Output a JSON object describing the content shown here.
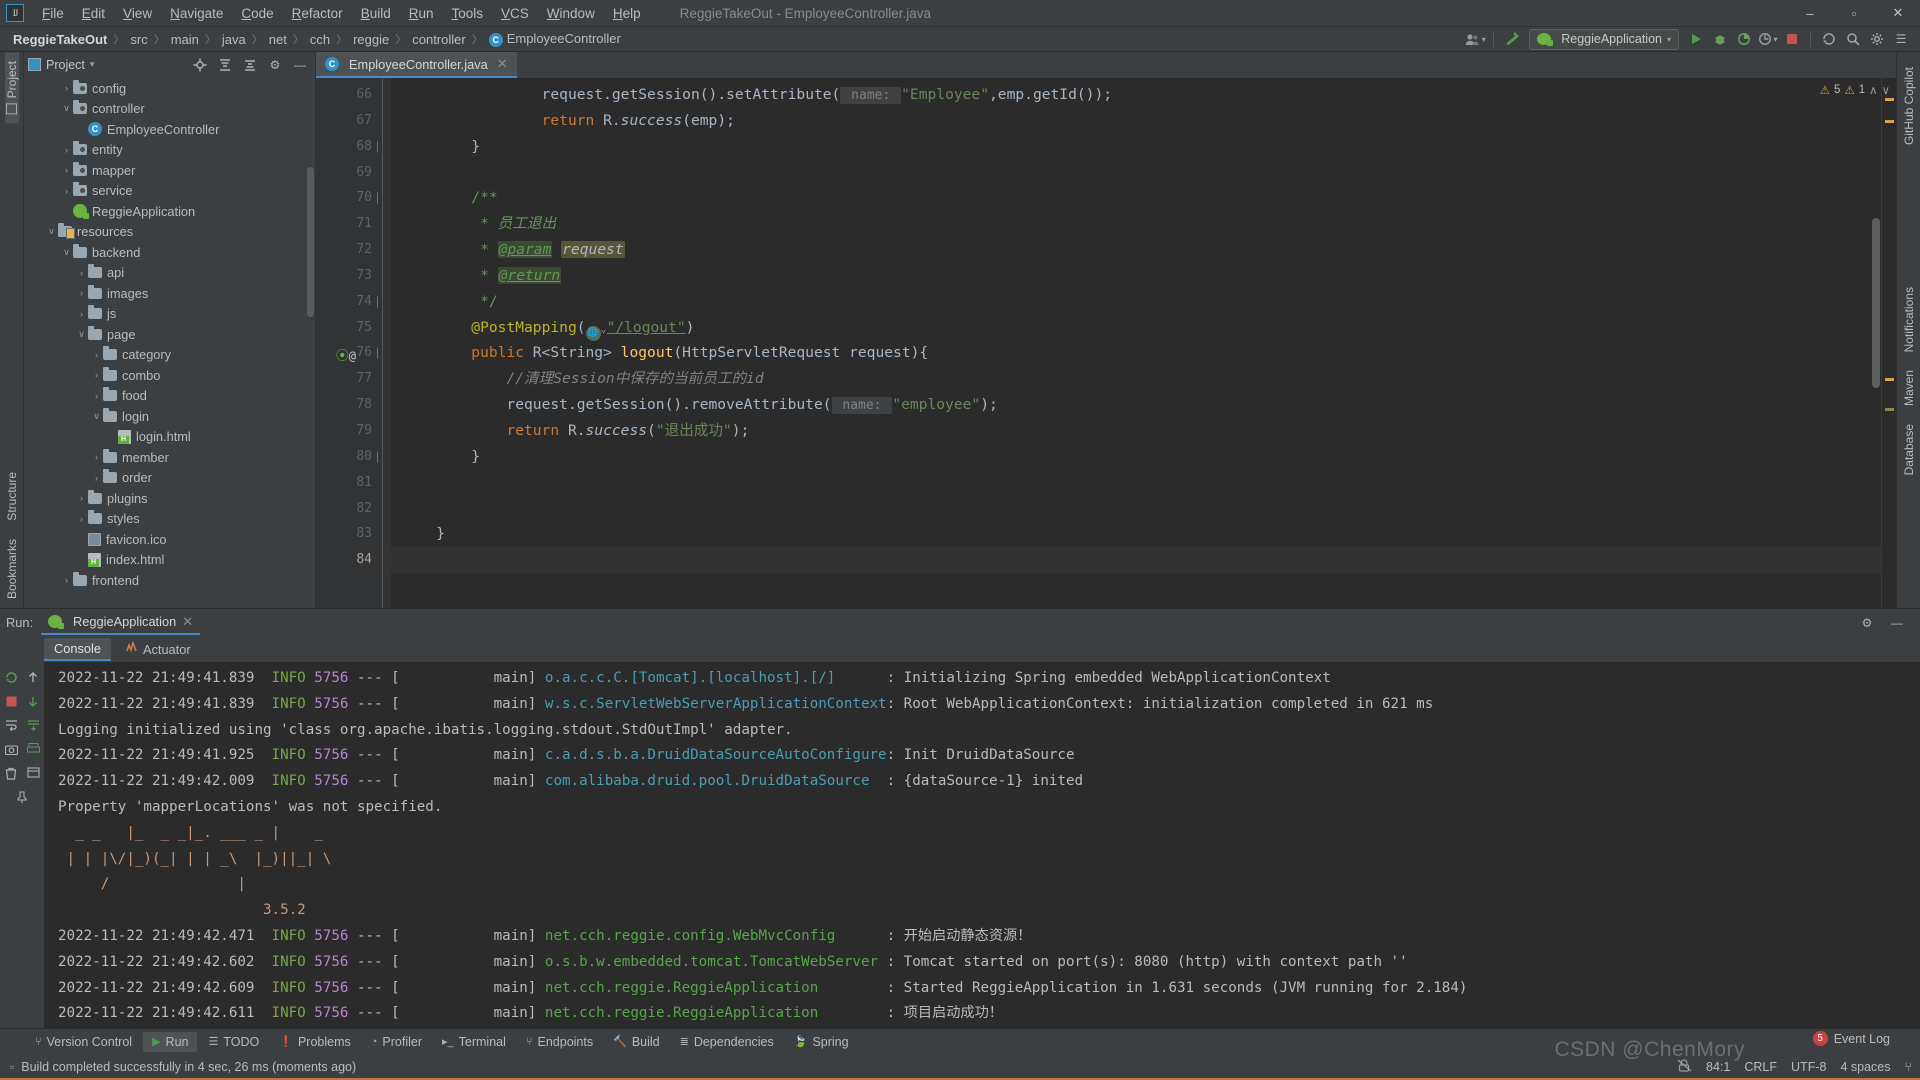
{
  "window": {
    "title": "ReggieTakeOut - EmployeeController.java",
    "minimize": "–",
    "maximize": "▫",
    "close": "✕"
  },
  "menu": {
    "logo": "IJ",
    "items": [
      "File",
      "Edit",
      "View",
      "Navigate",
      "Code",
      "Refactor",
      "Build",
      "Run",
      "Tools",
      "VCS",
      "Window",
      "Help"
    ]
  },
  "breadcrumb": {
    "project": "ReggieTakeOut",
    "parts": [
      "src",
      "main",
      "java",
      "net",
      "cch",
      "reggie",
      "controller"
    ],
    "file": "EmployeeController",
    "file_icon": "C",
    "separator": "〉"
  },
  "toolbar": {
    "profiles_icon": "👥",
    "hammer_icon": "build-hammer",
    "run_config": "ReggieApplication",
    "run_icon": "▶",
    "debug_icon": "🐞",
    "coverage_icon": "◷",
    "profile_icon": "◔",
    "stop_icon": "■",
    "update_icon": "↺",
    "search_icon": "🔍",
    "settings_icon": "⚙",
    "layout_icon": "☰"
  },
  "left_rail": {
    "project": "Project",
    "structure": "Structure",
    "bookmarks": "Bookmarks"
  },
  "right_rail": {
    "copilot": "GitHub Copilot",
    "notifications": "Notifications",
    "maven": "Maven",
    "database": "Database"
  },
  "project_panel": {
    "title": "Project",
    "dropdown": "▾",
    "locate_icon": "⊕",
    "expand_icon": "≡",
    "collapse_icon": "≣",
    "settings_icon": "⚙",
    "hide_icon": "—",
    "tree": [
      {
        "label": "config",
        "indent": 2,
        "arrow": "›",
        "icon": "folder-src"
      },
      {
        "label": "controller",
        "indent": 2,
        "arrow": "∨",
        "icon": "folder-src"
      },
      {
        "label": "EmployeeController",
        "indent": 3,
        "arrow": "",
        "icon": "class"
      },
      {
        "label": "entity",
        "indent": 2,
        "arrow": "›",
        "icon": "folder-src"
      },
      {
        "label": "mapper",
        "indent": 2,
        "arrow": "›",
        "icon": "folder-src"
      },
      {
        "label": "service",
        "indent": 2,
        "arrow": "›",
        "icon": "folder-src"
      },
      {
        "label": "ReggieApplication",
        "indent": 2,
        "arrow": "",
        "icon": "spring"
      },
      {
        "label": "resources",
        "indent": 1,
        "arrow": "∨",
        "icon": "folder-res"
      },
      {
        "label": "backend",
        "indent": 2,
        "arrow": "∨",
        "icon": "folder"
      },
      {
        "label": "api",
        "indent": 3,
        "arrow": "›",
        "icon": "folder"
      },
      {
        "label": "images",
        "indent": 3,
        "arrow": "›",
        "icon": "folder"
      },
      {
        "label": "js",
        "indent": 3,
        "arrow": "›",
        "icon": "folder"
      },
      {
        "label": "page",
        "indent": 3,
        "arrow": "∨",
        "icon": "folder"
      },
      {
        "label": "category",
        "indent": 4,
        "arrow": "›",
        "icon": "folder"
      },
      {
        "label": "combo",
        "indent": 4,
        "arrow": "›",
        "icon": "folder"
      },
      {
        "label": "food",
        "indent": 4,
        "arrow": "›",
        "icon": "folder"
      },
      {
        "label": "login",
        "indent": 4,
        "arrow": "∨",
        "icon": "folder"
      },
      {
        "label": "login.html",
        "indent": 5,
        "arrow": "",
        "icon": "html"
      },
      {
        "label": "member",
        "indent": 4,
        "arrow": "›",
        "icon": "folder"
      },
      {
        "label": "order",
        "indent": 4,
        "arrow": "›",
        "icon": "folder"
      },
      {
        "label": "plugins",
        "indent": 3,
        "arrow": "›",
        "icon": "folder"
      },
      {
        "label": "styles",
        "indent": 3,
        "arrow": "›",
        "icon": "folder"
      },
      {
        "label": "favicon.ico",
        "indent": 3,
        "arrow": "",
        "icon": "ico"
      },
      {
        "label": "index.html",
        "indent": 3,
        "arrow": "",
        "icon": "html"
      },
      {
        "label": "frontend",
        "indent": 2,
        "arrow": "›",
        "icon": "folder"
      }
    ]
  },
  "editor": {
    "tab": {
      "label": "EmployeeController.java",
      "icon": "C",
      "close": "✕"
    },
    "inspection": {
      "warnings": "5",
      "weak_warnings": "1",
      "warn_icon": "⚠",
      "weak_icon": "⚠",
      "up": "∧",
      "down": "∨"
    },
    "first_line_number": 66,
    "lines": [
      {
        "n": 66,
        "fold": "",
        "marks": "",
        "segments": [
          {
            "t": "                ",
            "c": "txt"
          },
          {
            "t": "request",
            "c": "txt"
          },
          {
            "t": ".getSession().setAttribute(",
            "c": "txt"
          },
          {
            "t": " name: ",
            "c": "hint"
          },
          {
            "t": "\"Employee\"",
            "c": "str"
          },
          {
            "t": ",emp.getId());",
            "c": "txt"
          }
        ]
      },
      {
        "n": 67,
        "fold": "",
        "marks": "",
        "segments": [
          {
            "t": "                ",
            "c": "txt"
          },
          {
            "t": "return",
            "c": "kw"
          },
          {
            "t": " R.",
            "c": "txt"
          },
          {
            "t": "success",
            "c": "txt-ital"
          },
          {
            "t": "(emp);",
            "c": "txt"
          }
        ]
      },
      {
        "n": 68,
        "fold": "⊖",
        "marks": "",
        "segments": [
          {
            "t": "        }",
            "c": "txt"
          }
        ]
      },
      {
        "n": 69,
        "fold": "",
        "marks": "",
        "segments": []
      },
      {
        "n": 70,
        "fold": "⊖",
        "marks": "",
        "segments": [
          {
            "t": "        ",
            "c": "txt"
          },
          {
            "t": "/**",
            "c": "jdoc"
          }
        ]
      },
      {
        "n": 71,
        "fold": "",
        "marks": "",
        "segments": [
          {
            "t": "         ",
            "c": "txt"
          },
          {
            "t": "* ",
            "c": "jdoc"
          },
          {
            "t": "员工退出",
            "c": "jdoc-ital"
          }
        ]
      },
      {
        "n": 72,
        "fold": "",
        "marks": "",
        "segments": [
          {
            "t": "         ",
            "c": "txt"
          },
          {
            "t": "* ",
            "c": "jdoc"
          },
          {
            "t": "@param",
            "c": "jdtag-hl"
          },
          {
            "t": " ",
            "c": "txt"
          },
          {
            "t": "request",
            "c": "param-hl"
          }
        ]
      },
      {
        "n": 73,
        "fold": "",
        "marks": "",
        "segments": [
          {
            "t": "         ",
            "c": "txt"
          },
          {
            "t": "* ",
            "c": "jdoc"
          },
          {
            "t": "@return",
            "c": "jdtag-hl"
          }
        ]
      },
      {
        "n": 74,
        "fold": "⊖",
        "marks": "",
        "segments": [
          {
            "t": "         ",
            "c": "txt"
          },
          {
            "t": "*/",
            "c": "jdoc"
          }
        ]
      },
      {
        "n": 75,
        "fold": "",
        "marks": "",
        "segments": [
          {
            "t": "        ",
            "c": "txt"
          },
          {
            "t": "@PostMapping",
            "c": "ann"
          },
          {
            "t": "(",
            "c": "txt"
          },
          {
            "t": "globe",
            "c": "globe-icon"
          },
          {
            "t": "\"/logout\"",
            "c": "linkstr"
          },
          {
            "t": ")",
            "c": "txt"
          }
        ]
      },
      {
        "n": 76,
        "fold": "⊖",
        "marks": "spring@",
        "segments": [
          {
            "t": "        ",
            "c": "txt"
          },
          {
            "t": "public",
            "c": "kw"
          },
          {
            "t": " R<String> ",
            "c": "txt"
          },
          {
            "t": "logout",
            "c": "fn"
          },
          {
            "t": "(HttpServletRequest request){",
            "c": "txt"
          }
        ]
      },
      {
        "n": 77,
        "fold": "",
        "marks": "",
        "segments": [
          {
            "t": "            ",
            "c": "txt"
          },
          {
            "t": "//清理Session中保存的当前员工的id",
            "c": "cmt-ital"
          }
        ]
      },
      {
        "n": 78,
        "fold": "",
        "marks": "",
        "segments": [
          {
            "t": "            ",
            "c": "txt"
          },
          {
            "t": "request.getSession().removeAttribute(",
            "c": "txt"
          },
          {
            "t": " name: ",
            "c": "hint"
          },
          {
            "t": "\"employee\"",
            "c": "str"
          },
          {
            "t": ");",
            "c": "txt"
          }
        ]
      },
      {
        "n": 79,
        "fold": "",
        "marks": "",
        "segments": [
          {
            "t": "            ",
            "c": "txt"
          },
          {
            "t": "return",
            "c": "kw"
          },
          {
            "t": " R.",
            "c": "txt"
          },
          {
            "t": "success",
            "c": "txt-ital"
          },
          {
            "t": "(",
            "c": "txt"
          },
          {
            "t": "\"退出成功\"",
            "c": "str"
          },
          {
            "t": ");",
            "c": "txt"
          }
        ]
      },
      {
        "n": 80,
        "fold": "⊖",
        "marks": "",
        "segments": [
          {
            "t": "        }",
            "c": "txt"
          }
        ]
      },
      {
        "n": 81,
        "fold": "",
        "marks": "",
        "segments": []
      },
      {
        "n": 82,
        "fold": "",
        "marks": "",
        "segments": []
      },
      {
        "n": 83,
        "fold": "",
        "marks": "",
        "segments": [
          {
            "t": "    }",
            "c": "txt"
          }
        ]
      },
      {
        "n": 84,
        "fold": "",
        "marks": "",
        "segments": []
      }
    ]
  },
  "run_panel": {
    "label": "Run:",
    "tab": "ReggieApplication",
    "tab_close": "✕",
    "settings_icon": "⚙",
    "hide_icon": "—",
    "sub_tabs": [
      {
        "label": "Console",
        "selected": true
      },
      {
        "label": "Actuator",
        "selected": false
      }
    ],
    "rail_icons": [
      "↻",
      "↑",
      "↓",
      "■",
      "⇥",
      "⎇",
      "📷",
      "⤓",
      "☰",
      "🗑",
      "⬇",
      "📌"
    ],
    "console_lines": [
      {
        "type": "log",
        "ts": "2022-11-22 21:49:41.839",
        "level": "INFO",
        "pid": "5756",
        "thread": "main]",
        "logger": "o.a.c.c.C.[Tomcat].[localhost].[/]",
        "colon": ":",
        "msg": "Initializing Spring embedded WebApplicationContext"
      },
      {
        "type": "log",
        "ts": "2022-11-22 21:49:41.839",
        "level": "INFO",
        "pid": "5756",
        "thread": "main]",
        "logger": "w.s.c.ServletWebServerApplicationContext",
        "colon": ":",
        "msg": "Root WebApplicationContext: initialization completed in 621 ms"
      },
      {
        "type": "plain",
        "text": "Logging initialized using 'class org.apache.ibatis.logging.stdout.StdOutImpl' adapter."
      },
      {
        "type": "log",
        "ts": "2022-11-22 21:49:41.925",
        "level": "INFO",
        "pid": "5756",
        "thread": "main]",
        "logger": "c.a.d.s.b.a.DruidDataSourceAutoConfigure",
        "colon": ":",
        "msg": "Init DruidDataSource"
      },
      {
        "type": "log",
        "ts": "2022-11-22 21:49:42.009",
        "level": "INFO",
        "pid": "5756",
        "thread": "main]",
        "logger": "com.alibaba.druid.pool.DruidDataSource",
        "colon": ":",
        "msg": "{dataSource-1} inited"
      },
      {
        "type": "plain",
        "text": "Property 'mapperLocations' was not specified."
      },
      {
        "type": "banner",
        "text": "  _ _   |_  _ _|_. ___ _ |    _ "
      },
      {
        "type": "banner",
        "text": " | | |\\/|_)(_| | | _\\  |_)||_| \\"
      },
      {
        "type": "banner",
        "text": "     /               |         "
      },
      {
        "type": "banner",
        "text": "                        3.5.2  "
      },
      {
        "type": "log",
        "ts": "2022-11-22 21:49:42.471",
        "level": "INFO",
        "pid": "5756",
        "thread": "main]",
        "logger": "net.cch.reggie.config.WebMvcConfig",
        "colon": ":",
        "msg": "开始启动静态资源！"
      },
      {
        "type": "log",
        "ts": "2022-11-22 21:49:42.602",
        "level": "INFO",
        "pid": "5756",
        "thread": "main]",
        "logger": "o.s.b.w.embedded.tomcat.TomcatWebServer",
        "colon": ":",
        "msg": "Tomcat started on port(s): 8080 (http) with context path ''"
      },
      {
        "type": "log",
        "ts": "2022-11-22 21:49:42.609",
        "level": "INFO",
        "pid": "5756",
        "thread": "main]",
        "logger": "net.cch.reggie.ReggieApplication",
        "colon": ":",
        "msg": "Started ReggieApplication in 1.631 seconds (JVM running for 2.184)"
      },
      {
        "type": "log",
        "ts": "2022-11-22 21:49:42.611",
        "level": "INFO",
        "pid": "5756",
        "thread": "main]",
        "logger": "net.cch.reggie.ReggieApplication",
        "colon": ":",
        "msg": "项目启动成功！"
      }
    ]
  },
  "tool_window_bar": [
    {
      "label": "Version Control",
      "icon": "⑂",
      "selected": false
    },
    {
      "label": "Run",
      "icon": "▶",
      "selected": true
    },
    {
      "label": "TODO",
      "icon": "☰",
      "selected": false
    },
    {
      "label": "Problems",
      "icon": "❗",
      "selected": false
    },
    {
      "label": "Profiler",
      "icon": "◔",
      "selected": false
    },
    {
      "label": "Terminal",
      "icon": "▸_",
      "selected": false
    },
    {
      "label": "Endpoints",
      "icon": "⑂",
      "selected": false
    },
    {
      "label": "Build",
      "icon": "🔨",
      "selected": false
    },
    {
      "label": "Dependencies",
      "icon": "≣",
      "selected": false
    },
    {
      "label": "Spring",
      "icon": "🍃",
      "selected": false
    }
  ],
  "status_bar": {
    "build_icon": "▫",
    "build_message": "Build completed successfully in 4 sec, 26 ms (moments ago)",
    "event_log": "Event Log",
    "event_log_count": "5",
    "lock_icon": "🔒",
    "position": "84:1",
    "line_sep": "CRLF",
    "encoding": "UTF-8",
    "indent": "4 spaces",
    "branch_icon": "⑂",
    "watermark": "CSDN @ChenMory"
  }
}
